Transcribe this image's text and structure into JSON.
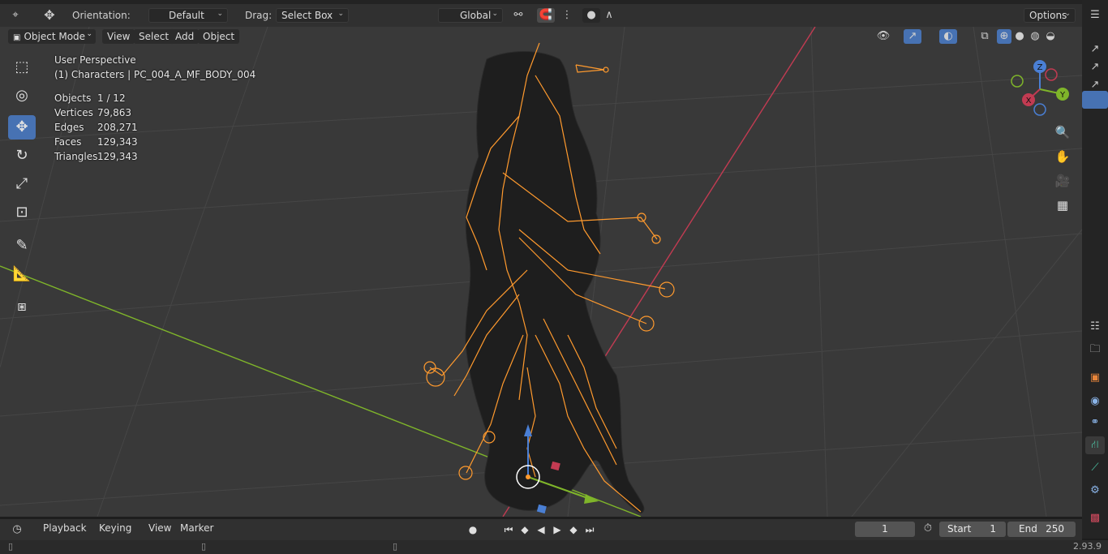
{
  "header": {
    "orientation_label": "Orientation:",
    "orientation_value": "Default",
    "drag_label": "Drag:",
    "drag_value": "Select Box",
    "transform_space": "Global",
    "options_label": "Options"
  },
  "menu": {
    "mode": "Object Mode",
    "view": "View",
    "select": "Select",
    "add": "Add",
    "object": "Object"
  },
  "overlay": {
    "perspective": "User Perspective",
    "collection": "(1) Characters | PC_004_A_MF_BODY_004",
    "stats": [
      {
        "label": "Objects",
        "value": "1 / 12"
      },
      {
        "label": "Vertices",
        "value": "79,863"
      },
      {
        "label": "Edges",
        "value": "208,271"
      },
      {
        "label": "Faces",
        "value": "129,343"
      },
      {
        "label": "Triangles",
        "value": "129,343"
      }
    ]
  },
  "gizmo": {
    "z": "Z",
    "y": "Y",
    "x": "X"
  },
  "timeline": {
    "playback": "Playback",
    "keying": "Keying",
    "view": "View",
    "marker": "Marker",
    "current_frame": "1",
    "start_label": "Start",
    "start_value": "1",
    "end_label": "End",
    "end_value": "250"
  },
  "status": {
    "version": "2.93.9"
  },
  "colors": {
    "accent": "#4772b3",
    "bone": "#ff9a2e",
    "x_axis": "#c23b52",
    "y_axis": "#7fb52a"
  }
}
